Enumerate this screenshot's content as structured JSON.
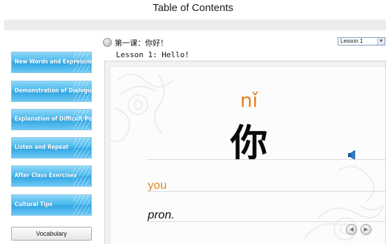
{
  "header": {
    "title": "Table of Contents"
  },
  "sidebar": {
    "items": [
      {
        "label": "New Words and Expressions"
      },
      {
        "label": "Demonstration of Dialogues"
      },
      {
        "label": "Explanation of Difficult Points"
      },
      {
        "label": "Listen and Repeat"
      },
      {
        "label": "After Class Exercises"
      },
      {
        "label": "Cultural Tips"
      }
    ],
    "vocabulary_label": "Vocabulary"
  },
  "lesson": {
    "title_cn": "第一课：你好！",
    "title_en": "Lesson 1: Hello!",
    "selector_value": "Lesson 1"
  },
  "card": {
    "pinyin": "nǐ",
    "character": "你",
    "meaning": "you",
    "part_of_speech": "pron."
  },
  "colors": {
    "accent_orange": "#e67e1f",
    "nav_blue": "#2fa6e4"
  },
  "icons": {
    "speaker": "speaker-icon",
    "prev": "previous-arrow-icon",
    "next": "next-arrow-icon"
  }
}
